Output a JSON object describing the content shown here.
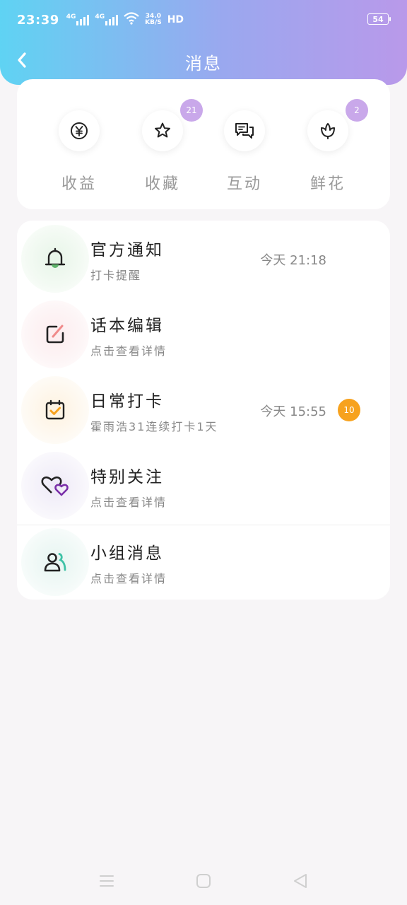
{
  "status_bar": {
    "time": "23:39",
    "net_speed_top": "34.0",
    "net_speed_unit": "KB/S",
    "hd": "HD",
    "battery": "54",
    "signal1_label": "4G",
    "signal2_label": "4G"
  },
  "header": {
    "title": "消息",
    "back_icon": "chevron-left-icon"
  },
  "categories": [
    {
      "label": "收益",
      "icon": "yen-coin-icon",
      "badge": ""
    },
    {
      "label": "收藏",
      "icon": "star-icon",
      "badge": "21"
    },
    {
      "label": "互动",
      "icon": "chat-bubbles-icon",
      "badge": ""
    },
    {
      "label": "鲜花",
      "icon": "flower-icon",
      "badge": "2"
    }
  ],
  "messages": [
    {
      "title": "官方通知",
      "subtitle": "打卡提醒",
      "time": "今天 21:18",
      "badge": "",
      "icon": "bell-icon"
    },
    {
      "title": "话本编辑",
      "subtitle": "点击查看详情",
      "time": "",
      "badge": "",
      "icon": "edit-icon"
    },
    {
      "title": "日常打卡",
      "subtitle": "霍雨浩31连续打卡1天",
      "time": "今天 15:55",
      "badge": "10",
      "icon": "calendar-check-icon"
    },
    {
      "title": "特别关注",
      "subtitle": "点击查看详情",
      "time": "",
      "badge": "",
      "icon": "double-heart-icon"
    },
    {
      "title": "小组消息",
      "subtitle": "点击查看详情",
      "time": "",
      "badge": "",
      "icon": "group-icon"
    }
  ],
  "colors": {
    "header_gradient_start": "#5fd3f3",
    "header_gradient_end": "#b999ea",
    "category_badge": "#c9a8ea",
    "unread_badge": "#f7a21e"
  },
  "system_nav": {
    "menu_icon": "menu-icon",
    "home_icon": "home-square-icon",
    "back_icon": "back-triangle-icon"
  }
}
